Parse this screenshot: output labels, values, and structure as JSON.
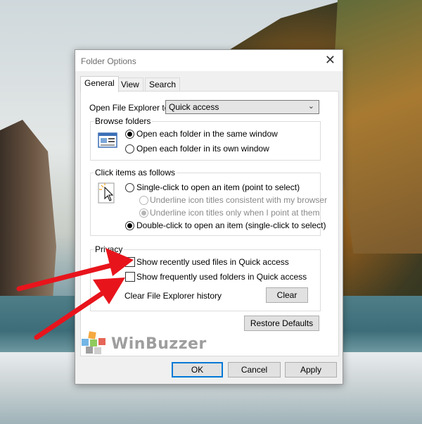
{
  "dialog": {
    "title": "Folder Options",
    "close_glyph": "✕"
  },
  "tabs": [
    {
      "label": "General",
      "active": true
    },
    {
      "label": "View",
      "active": false
    },
    {
      "label": "Search",
      "active": false
    }
  ],
  "open_to": {
    "label": "Open File Explorer to:",
    "value": "Quick access"
  },
  "browse_folders": {
    "title": "Browse folders",
    "icon": "browse-folders-icon",
    "options": [
      {
        "label": "Open each folder in the same window",
        "selected": true
      },
      {
        "label": "Open each folder in its own window",
        "selected": false
      }
    ]
  },
  "click_items": {
    "title": "Click items as follows",
    "icon": "mouse-click-icon",
    "single_click": {
      "label": "Single-click to open an item (point to select)",
      "selected": false
    },
    "underline_consistent": {
      "label": "Underline icon titles consistent with my browser",
      "selected": false,
      "disabled": true
    },
    "underline_point": {
      "label": "Underline icon titles only when I point at them",
      "selected": true,
      "disabled": true
    },
    "double_click": {
      "label": "Double-click to open an item (single-click to select)",
      "selected": true
    }
  },
  "privacy": {
    "title": "Privacy",
    "recent_files": {
      "label": "Show recently used files in Quick access",
      "checked": false
    },
    "frequent_folders": {
      "label": "Show frequently used folders in Quick access",
      "checked": false
    },
    "clear_history_label": "Clear File Explorer history",
    "clear_button": "Clear"
  },
  "restore_defaults": "Restore Defaults",
  "footer": {
    "ok": "OK",
    "cancel": "Cancel",
    "apply": "Apply"
  },
  "watermark": {
    "text": "WinBuzzer",
    "icon": "winbuzzer-logo-icon"
  },
  "colors": {
    "annotation_arrow": "#e8141c",
    "focus_border": "#0078d7"
  }
}
